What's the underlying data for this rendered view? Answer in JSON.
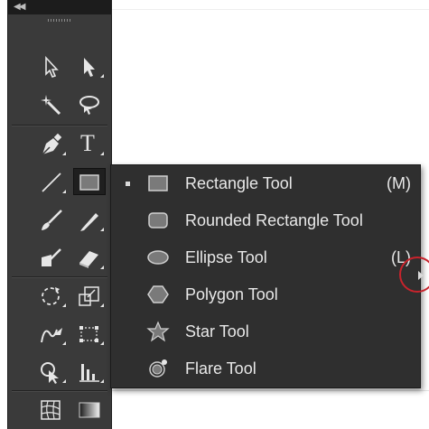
{
  "toolbar": {
    "collapse_glyph": "◀◀",
    "tools": [
      {
        "name": "selection-tool",
        "icon": "black-arrow-outline-icon"
      },
      {
        "name": "direct-selection-tool",
        "icon": "white-arrow-icon"
      },
      {
        "name": "magic-wand-tool",
        "icon": "magic-wand-icon"
      },
      {
        "name": "lasso-tool",
        "icon": "lasso-icon"
      },
      {
        "name": "pen-tool",
        "icon": "pen-nib-icon"
      },
      {
        "name": "type-tool",
        "icon": "type-t-icon",
        "glyph": "T"
      },
      {
        "name": "line-segment-tool",
        "icon": "line-icon"
      },
      {
        "name": "rectangle-tool",
        "icon": "rectangle-icon"
      },
      {
        "name": "paintbrush-tool",
        "icon": "brush-icon"
      },
      {
        "name": "pencil-tool",
        "icon": "pencil-icon"
      },
      {
        "name": "blob-brush-tool",
        "icon": "blob-brush-icon"
      },
      {
        "name": "eraser-tool",
        "icon": "eraser-icon"
      },
      {
        "name": "rotate-tool",
        "icon": "rotate-icon"
      },
      {
        "name": "scale-tool",
        "icon": "scale-icon"
      },
      {
        "name": "warp-tool",
        "icon": "warp-icon"
      },
      {
        "name": "free-transform-tool",
        "icon": "free-transform-icon"
      },
      {
        "name": "shape-builder-tool",
        "icon": "shape-builder-icon"
      },
      {
        "name": "graph-tool",
        "icon": "column-graph-icon"
      },
      {
        "name": "mesh-tool",
        "icon": "mesh-icon"
      },
      {
        "name": "gradient-tool",
        "icon": "gradient-icon"
      }
    ]
  },
  "flyout": {
    "items": [
      {
        "label": "Rectangle Tool",
        "shortcut": "(M)",
        "checked": true,
        "icon": "rectangle-icon"
      },
      {
        "label": "Rounded Rectangle Tool",
        "shortcut": "",
        "checked": false,
        "icon": "rounded-rectangle-icon"
      },
      {
        "label": "Ellipse Tool",
        "shortcut": "(L)",
        "checked": false,
        "icon": "ellipse-icon"
      },
      {
        "label": "Polygon Tool",
        "shortcut": "",
        "checked": false,
        "icon": "polygon-icon"
      },
      {
        "label": "Star Tool",
        "shortcut": "",
        "checked": false,
        "icon": "star-icon"
      },
      {
        "label": "Flare Tool",
        "shortcut": "",
        "checked": false,
        "icon": "flare-icon"
      }
    ]
  },
  "colors": {
    "panel": "#3a3a3a",
    "flyout": "#2f2f2f",
    "icon": "#e6e6e6",
    "highlight_circle": "#c8232c"
  }
}
